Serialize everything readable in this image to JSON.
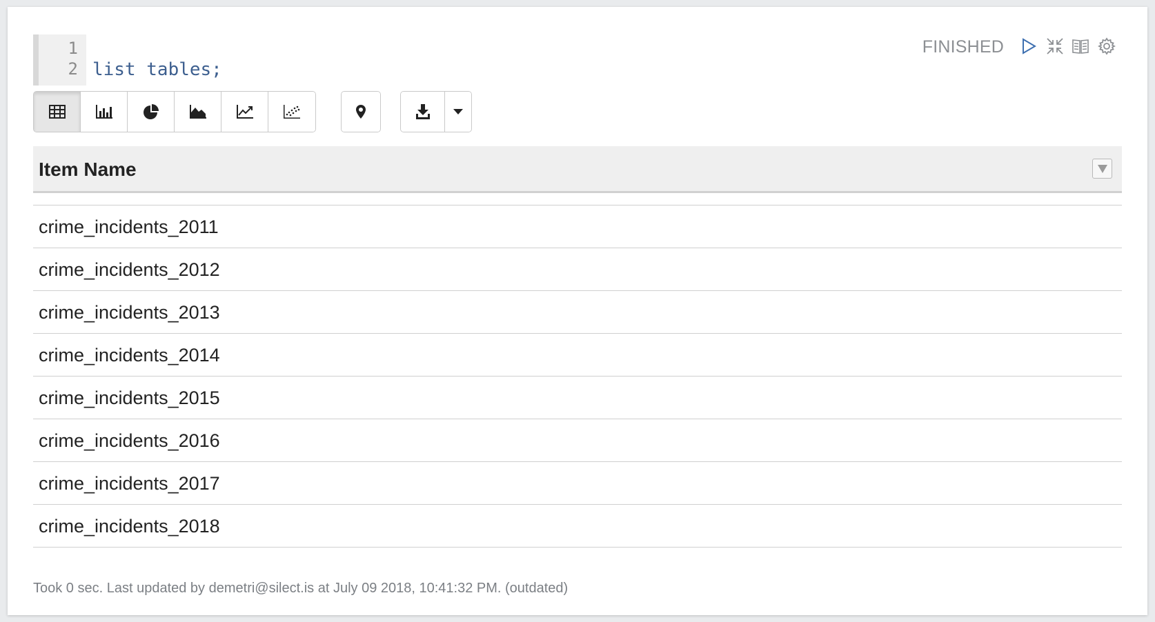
{
  "editor": {
    "lines": [
      {
        "num": "1",
        "code": ""
      },
      {
        "num": "2",
        "code": "list tables;"
      }
    ]
  },
  "status": {
    "label": "FINISHED"
  },
  "controls": {
    "icons": [
      "run-icon",
      "collapse-icon",
      "book-icon",
      "gear-icon"
    ]
  },
  "toolbar": {
    "views": [
      "table-icon",
      "bar-chart-icon",
      "pie-chart-icon",
      "area-chart-icon",
      "line-chart-icon",
      "scatter-chart-icon"
    ],
    "active_view": "table-icon"
  },
  "table": {
    "column": "Item Name",
    "rows": [
      "crime_incidents_2011",
      "crime_incidents_2012",
      "crime_incidents_2013",
      "crime_incidents_2014",
      "crime_incidents_2015",
      "crime_incidents_2016",
      "crime_incidents_2017",
      "crime_incidents_2018"
    ]
  },
  "footer": {
    "text": "Took 0 sec. Last updated by demetri@silect.is at July 09 2018, 10:41:32 PM. (outdated)"
  },
  "colors": {
    "accent": "#3d5f8f",
    "status": "#8c8f93",
    "header_bg": "#efefef"
  }
}
